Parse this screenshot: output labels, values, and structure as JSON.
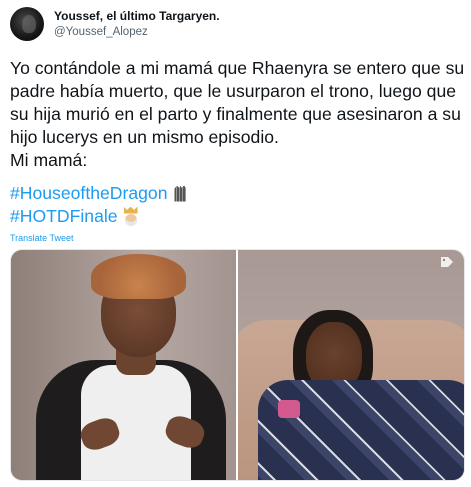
{
  "tweet": {
    "display_name": "Youssef, el último Targaryen.",
    "handle": "@Youssef_Alopez",
    "text_lines": [
      "Yo contándole a mi mamá que Rhaenyra se entero que su",
      "padre había muerto, que le usurparon el trono, luego que",
      "su hija murió en el parto y finalmente que asesinaron a su",
      "hijo lucerys en un mismo episodio.",
      "Mi mamá:"
    ],
    "hashtags": [
      {
        "text": "#HouseoftheDragon",
        "emoji": "throne-emoji"
      },
      {
        "text": "#HOTDFinale",
        "emoji": "king-emoji"
      }
    ],
    "translate_label": "Translate Tweet"
  },
  "media": {
    "left_image": "crying-woman-photo",
    "right_image": "woman-under-blanket-photo",
    "tag_icon": "tag-icon"
  },
  "colors": {
    "link": "#1d9bf0",
    "text": "#0f1419",
    "secondary": "#536471"
  }
}
